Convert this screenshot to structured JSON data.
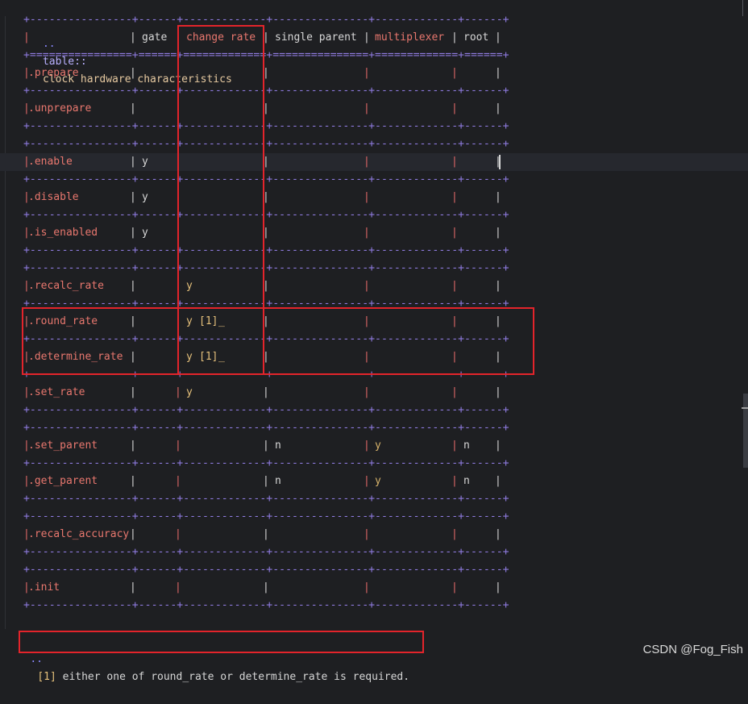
{
  "directive": {
    "dots": "..",
    "keyword": "table::",
    "title": "clock hardware characteristics"
  },
  "separator_dash": "+----------------+------+-------------+---------------+-------------+------+",
  "separator_eq": "+================+======+=============+===============+=============+======+",
  "header": {
    "gate": "gate",
    "change_rate": "change rate",
    "single_parent": "single parent",
    "multiplexer": "multiplexer",
    "root": "root"
  },
  "rows": [
    {
      "op": ".prepare",
      "gate": "",
      "change": "",
      "single": "",
      "mux": "",
      "root": ""
    },
    {
      "op": ".unprepare",
      "gate": "",
      "change": "",
      "single": "",
      "mux": "",
      "root": ""
    },
    {
      "op": ".enable",
      "gate": "y",
      "change": "",
      "single": "",
      "mux": "",
      "root": ""
    },
    {
      "op": ".disable",
      "gate": "y",
      "change": "",
      "single": "",
      "mux": "",
      "root": ""
    },
    {
      "op": ".is_enabled",
      "gate": "y",
      "change": "",
      "single": "",
      "mux": "",
      "root": ""
    },
    {
      "op": ".recalc_rate",
      "gate": "",
      "change": "y",
      "single": "",
      "mux": "",
      "root": ""
    },
    {
      "op": ".round_rate",
      "gate": "",
      "change": "y",
      "change_ref": "[1]",
      "change_tail": "_",
      "single": "",
      "mux": "",
      "root": ""
    },
    {
      "op": ".determine_rate",
      "gate": "",
      "change": "y",
      "change_ref": "[1]",
      "change_tail": "_",
      "single": "",
      "mux": "",
      "root": ""
    },
    {
      "op": ".set_rate",
      "gate": "",
      "change": "y",
      "single": "",
      "mux": "",
      "root": ""
    },
    {
      "op": ".set_parent",
      "gate": "",
      "change": "",
      "single": "n",
      "mux": "y",
      "root": "n"
    },
    {
      "op": ".get_parent",
      "gate": "",
      "change": "",
      "single": "n",
      "mux": "y",
      "root": "n"
    },
    {
      "op": ".recalc_accuracy",
      "gate": "",
      "change": "",
      "single": "",
      "mux": "",
      "root": ""
    },
    {
      "op": ".init",
      "gate": "",
      "change": "",
      "single": "",
      "mux": "",
      "root": ""
    }
  ],
  "footnote": {
    "dots": "..",
    "ref": "[1]",
    "text": " either one of round_rate or determine_rate is required."
  },
  "watermark": "CSDN @Fog_Fish",
  "colors": {
    "background": "#1e1f22",
    "annotation_red": "#e3242b",
    "separator_purple": "#8f7be0",
    "function_red": "#e8776e",
    "value_yellow": "#e5c07b"
  }
}
